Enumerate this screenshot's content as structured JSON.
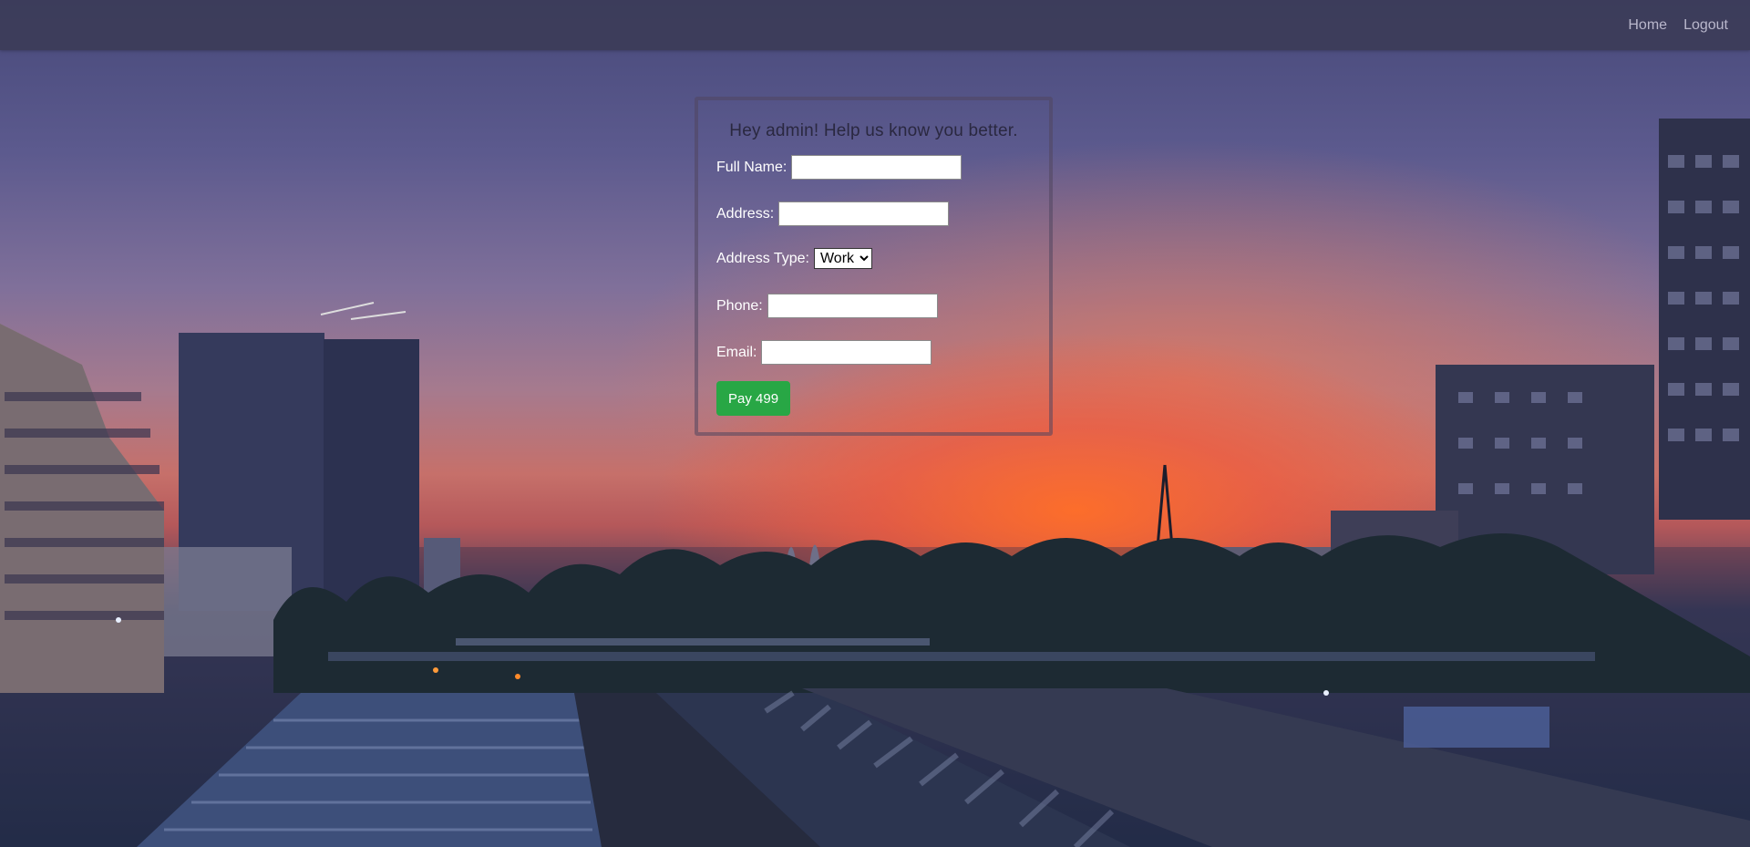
{
  "nav": {
    "links": [
      {
        "label": "Home"
      },
      {
        "label": "Logout"
      }
    ]
  },
  "form": {
    "title": "Hey admin! Help us know you better.",
    "fields": {
      "full_name": {
        "label": "Full Name:",
        "value": ""
      },
      "address": {
        "label": "Address:",
        "value": ""
      },
      "address_type": {
        "label": "Address Type:",
        "selected": "Work"
      },
      "phone": {
        "label": "Phone:",
        "value": ""
      },
      "email": {
        "label": "Email:",
        "value": ""
      }
    },
    "submit_label": "Pay 499"
  },
  "colors": {
    "navbar": "#3c3c58",
    "button": "#28a745",
    "sunset": "#f06a30",
    "sky": "#47497a"
  }
}
